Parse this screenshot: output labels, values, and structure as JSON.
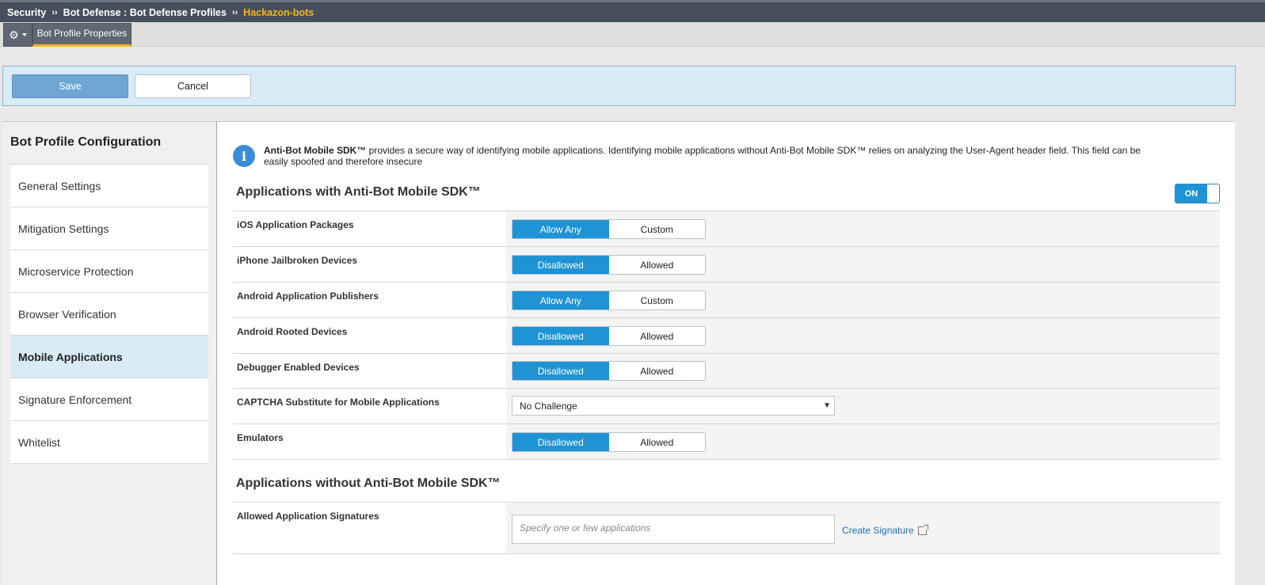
{
  "breadcrumb": {
    "items": [
      "Security",
      "Bot Defense : Bot Defense Profiles",
      "Hackazon-bots"
    ],
    "separator": "››"
  },
  "tabs": {
    "gear_icon": "gear-icon",
    "active_tab": "Bot Profile Properties"
  },
  "actions": {
    "save_label": "Save",
    "cancel_label": "Cancel"
  },
  "sidebar": {
    "title": "Bot Profile Configuration",
    "items": [
      {
        "label": "General Settings",
        "selected": false
      },
      {
        "label": "Mitigation Settings",
        "selected": false
      },
      {
        "label": "Microservice Protection",
        "selected": false
      },
      {
        "label": "Browser Verification",
        "selected": false
      },
      {
        "label": "Mobile Applications",
        "selected": true
      },
      {
        "label": "Signature Enforcement",
        "selected": false
      },
      {
        "label": "Whitelist",
        "selected": false
      }
    ]
  },
  "info": {
    "icon": "info-icon",
    "bold_text": "Anti-Bot Mobile SDK™",
    "text": " provides a secure way of identifying mobile applications. Identifying mobile applications without Anti-Bot Mobile SDK™ relies on analyzing the User-Agent header field. This field can be easily spoofed and therefore insecure"
  },
  "with_sdk": {
    "title": "Applications with Anti-Bot Mobile SDK™",
    "toggle_label": "ON",
    "rows": [
      {
        "label": "iOS Application Packages",
        "options": [
          "Allow Any",
          "Custom"
        ],
        "selected": 0
      },
      {
        "label": "iPhone Jailbroken Devices",
        "options": [
          "Disallowed",
          "Allowed"
        ],
        "selected": 0
      },
      {
        "label": "Android Application Publishers",
        "options": [
          "Allow Any",
          "Custom"
        ],
        "selected": 0
      },
      {
        "label": "Android Rooted Devices",
        "options": [
          "Disallowed",
          "Allowed"
        ],
        "selected": 0
      },
      {
        "label": "Debugger Enabled Devices",
        "options": [
          "Disallowed",
          "Allowed"
        ],
        "selected": 0
      },
      {
        "label": "CAPTCHA Substitute for Mobile Applications",
        "select_value": "No Challenge"
      },
      {
        "label": "Emulators",
        "options": [
          "Disallowed",
          "Allowed"
        ],
        "selected": 0
      }
    ]
  },
  "without_sdk": {
    "title": "Applications without Anti-Bot Mobile SDK™",
    "signatures_label": "Allowed Application Signatures",
    "signatures_placeholder": "Specify one or few applications",
    "create_link": "Create Signature",
    "link_icon": "external-link-icon"
  }
}
